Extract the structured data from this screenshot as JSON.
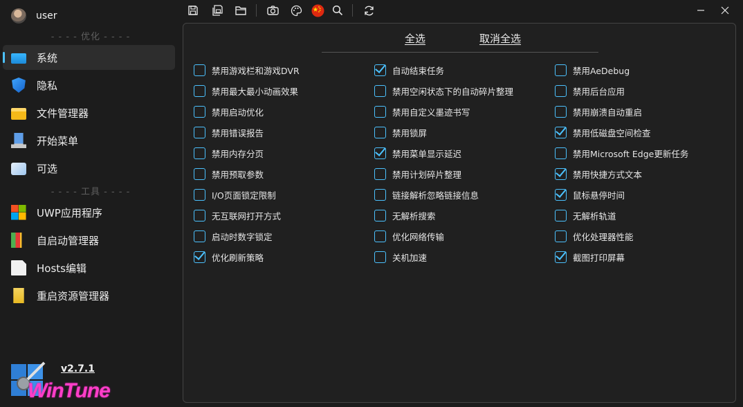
{
  "user": {
    "name": "user"
  },
  "sidebar": {
    "sep_optimize": "- - - - 优化 - - - -",
    "sep_tools": "- - - - 工具 - - - -",
    "items": [
      {
        "label": "系统",
        "icon": "system-icon"
      },
      {
        "label": "隐私",
        "icon": "privacy-shield-icon"
      },
      {
        "label": "文件管理器",
        "icon": "folder-icon"
      },
      {
        "label": "开始菜单",
        "icon": "start-menu-icon"
      },
      {
        "label": "可选",
        "icon": "optional-features-icon"
      },
      {
        "label": "UWP应用程序",
        "icon": "uwp-apps-icon"
      },
      {
        "label": "自启动管理器",
        "icon": "autostart-icon"
      },
      {
        "label": "Hosts编辑",
        "icon": "hosts-file-icon"
      },
      {
        "label": "重启资源管理器",
        "icon": "explorer-restart-icon"
      }
    ]
  },
  "footer": {
    "logo_text": "WinTune",
    "version": "v2.7.1"
  },
  "toolbar": {
    "icons": [
      "save-icon",
      "save-all-icon",
      "open-folder-icon",
      "camera-icon",
      "theme-palette-icon",
      "china-flag-icon",
      "search-icon",
      "refresh-icon"
    ],
    "window": [
      "minimize-icon",
      "close-icon"
    ]
  },
  "main": {
    "select_all": "全选",
    "deselect_all": "取消全选",
    "columns": [
      [
        {
          "label": "禁用游戏栏和游戏DVR",
          "checked": false
        },
        {
          "label": "禁用最大最小动画效果",
          "checked": false
        },
        {
          "label": "禁用启动优化",
          "checked": false
        },
        {
          "label": "禁用错误报告",
          "checked": false
        },
        {
          "label": "禁用内存分页",
          "checked": false
        },
        {
          "label": "禁用预取参数",
          "checked": false
        },
        {
          "label": "I/O页面锁定限制",
          "checked": false
        },
        {
          "label": "无互联网打开方式",
          "checked": false
        },
        {
          "label": "启动时数字锁定",
          "checked": false
        },
        {
          "label": "优化刷新策略",
          "checked": true
        }
      ],
      [
        {
          "label": "自动结束任务",
          "checked": true
        },
        {
          "label": "禁用空闲状态下的自动碎片整理",
          "checked": false
        },
        {
          "label": "禁用自定义墨迹书写",
          "checked": false
        },
        {
          "label": "禁用锁屏",
          "checked": false
        },
        {
          "label": "禁用菜单显示延迟",
          "checked": true
        },
        {
          "label": "禁用计划碎片整理",
          "checked": false
        },
        {
          "label": "链接解析忽略链接信息",
          "checked": false
        },
        {
          "label": "无解析搜索",
          "checked": false
        },
        {
          "label": "优化网络传输",
          "checked": false
        },
        {
          "label": "关机加速",
          "checked": false
        }
      ],
      [
        {
          "label": "禁用AeDebug",
          "checked": false
        },
        {
          "label": "禁用后台应用",
          "checked": false
        },
        {
          "label": "禁用崩溃自动重启",
          "checked": false
        },
        {
          "label": "禁用低磁盘空间检查",
          "checked": true
        },
        {
          "label": "禁用Microsoft Edge更新任务",
          "checked": false
        },
        {
          "label": "禁用快捷方式文本",
          "checked": true
        },
        {
          "label": "鼠标悬停时间",
          "checked": true
        },
        {
          "label": "无解析轨道",
          "checked": false
        },
        {
          "label": "优化处理器性能",
          "checked": false
        },
        {
          "label": "截图打印屏幕",
          "checked": true
        }
      ]
    ]
  },
  "colors": {
    "accent": "#4cc2ff",
    "background": "#1c1c1c",
    "panel": "#202020",
    "logo": "#ff3ec8"
  }
}
